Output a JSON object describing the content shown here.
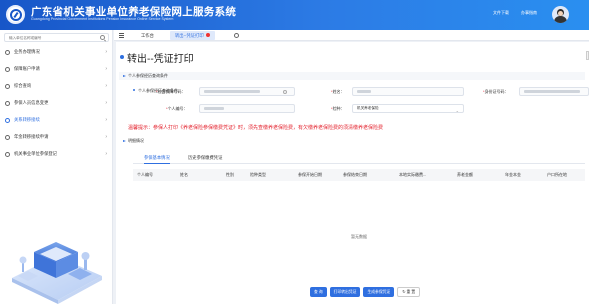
{
  "header": {
    "title": "广东省机关事业单位养老保险网上服务系统",
    "subtitle": "Guangdong Provincial Government Institutions Pension Insurance Online Service System",
    "links": [
      "文件下载",
      "办事指南"
    ]
  },
  "sidebar": {
    "search_placeholder": "输入单位名称或编号",
    "items": [
      {
        "label": "业务办理情况",
        "active": false
      },
      {
        "label": "保障账户申请",
        "active": false
      },
      {
        "label": "综合查询",
        "active": false
      },
      {
        "label": "参保人员信息变更",
        "active": false
      },
      {
        "label": "关系转移接续",
        "active": true
      },
      {
        "label": "年金转移接续申请",
        "active": false
      },
      {
        "label": "机关事业单位参保登记",
        "active": false
      }
    ]
  },
  "tabbar": {
    "home": "工作台",
    "current": "转出--凭证打印"
  },
  "page": {
    "title": "转出--凭证打印",
    "section_query": "个人参保经历查询条件",
    "fields": {
      "ssn_label": "社会保障号码：",
      "name_label": "姓名：",
      "id_label": "身份证号码：",
      "personal_no_label": "个人编号：",
      "insurance_label": "险种：",
      "insurance_value": "机关养老保险"
    },
    "warning": "温馨提示：参保人打印《养老保险参保缴费凭证》时，须先查缴养老保险费，有欠缴养老保险费的须清缴养老保险费",
    "section_info": "明细情况"
  },
  "subtabs": [
    "参保基本情况",
    "历史参保缴费凭证"
  ],
  "table": {
    "columns": [
      "个人编号",
      "姓名",
      "性别",
      "险种类型",
      "参保开始日期",
      "参保结束日期",
      "本地实际缴费...",
      "养老金额",
      "年金本金",
      "户口所在地"
    ],
    "empty_text": "暂无数据"
  },
  "actions": {
    "query": "查 询",
    "print_transfer": "打印转出凭证",
    "generate": "生成参保凭证",
    "reset": "重 置"
  },
  "colors": {
    "header_blue": "#1756c8",
    "accent": "#2f6fe0",
    "warning_red": "#e4232e"
  }
}
